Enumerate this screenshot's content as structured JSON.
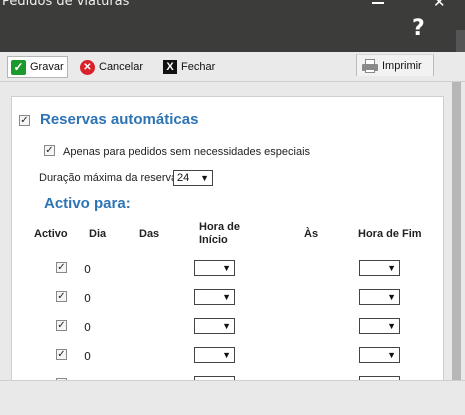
{
  "window": {
    "title": "Pedidos de viaturas",
    "help": "?"
  },
  "toolbar": {
    "save": "Gravar",
    "cancel": "Cancelar",
    "close": "Fechar",
    "print": "Imprimir"
  },
  "reservas": {
    "auto_label": "Reservas automáticas",
    "auto_checked": true,
    "special_label": "Apenas para pedidos sem necessidades especiais",
    "special_checked": true,
    "duration_label": "Duração máxima da reserva",
    "duration_value": "24"
  },
  "activo": {
    "title": "Activo para:",
    "headers": {
      "activo": "Activo",
      "dia": "Dia",
      "das": "Das",
      "hora_inicio": "Hora de Início",
      "as": "Às",
      "hora_fim": "Hora de Fim"
    },
    "rows": [
      {
        "checked": true,
        "dia": "0",
        "hora_inicio": "",
        "hora_fim": ""
      },
      {
        "checked": true,
        "dia": "0",
        "hora_inicio": "",
        "hora_fim": ""
      },
      {
        "checked": true,
        "dia": "0",
        "hora_inicio": "",
        "hora_fim": ""
      },
      {
        "checked": true,
        "dia": "0",
        "hora_inicio": "",
        "hora_fim": ""
      }
    ]
  }
}
